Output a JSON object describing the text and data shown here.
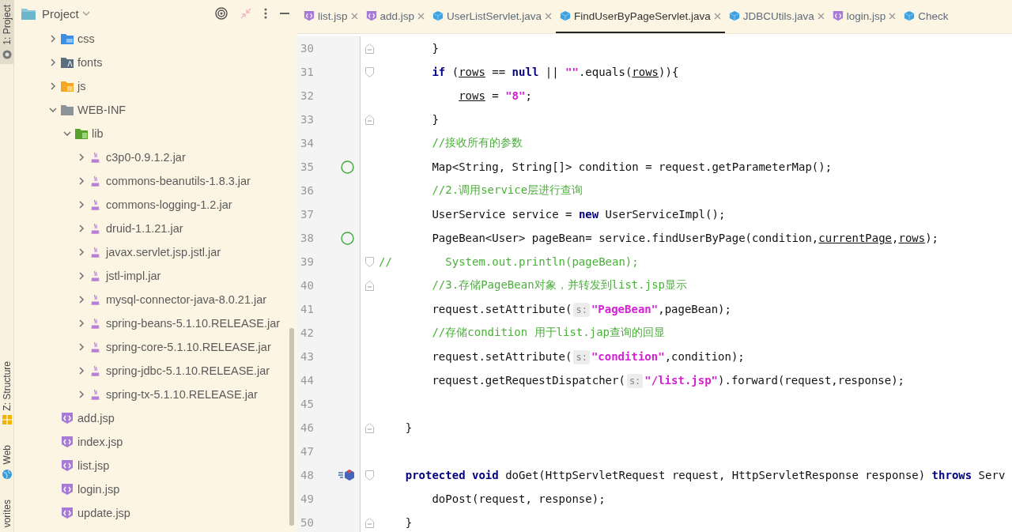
{
  "tool_stripe": [
    {
      "label": "1: Project",
      "kind": "project",
      "selected": true
    },
    {
      "label": "Z: Structure",
      "kind": "structure",
      "selected": false
    },
    {
      "label": "Web",
      "kind": "web",
      "selected": false
    },
    {
      "label": "vorites",
      "kind": "favorites",
      "selected": false
    }
  ],
  "project_panel": {
    "title": "Project",
    "tree": [
      {
        "label": "css",
        "kind": "css-folder",
        "expanded": false
      },
      {
        "label": "fonts",
        "kind": "fonts-folder",
        "expanded": false
      },
      {
        "label": "js",
        "kind": "js-folder",
        "expanded": false
      },
      {
        "label": "WEB-INF",
        "kind": "folder",
        "expanded": true,
        "children": [
          {
            "label": "lib",
            "kind": "lib-folder",
            "expanded": true,
            "children": [
              {
                "label": "c3p0-0.9.1.2.jar",
                "kind": "jar",
                "expanded": false
              },
              {
                "label": "commons-beanutils-1.8.3.jar",
                "kind": "jar",
                "expanded": false
              },
              {
                "label": "commons-logging-1.2.jar",
                "kind": "jar",
                "expanded": false
              },
              {
                "label": "druid-1.1.21.jar",
                "kind": "jar",
                "expanded": false
              },
              {
                "label": "javax.servlet.jsp.jstl.jar",
                "kind": "jar",
                "expanded": false
              },
              {
                "label": "jstl-impl.jar",
                "kind": "jar",
                "expanded": false
              },
              {
                "label": "mysql-connector-java-8.0.21.jar",
                "kind": "jar",
                "expanded": false
              },
              {
                "label": "spring-beans-5.1.10.RELEASE.jar",
                "kind": "jar",
                "expanded": false
              },
              {
                "label": "spring-core-5.1.10.RELEASE.jar",
                "kind": "jar",
                "expanded": false
              },
              {
                "label": "spring-jdbc-5.1.10.RELEASE.jar",
                "kind": "jar",
                "expanded": false
              },
              {
                "label": "spring-tx-5.1.10.RELEASE.jar",
                "kind": "jar",
                "expanded": false
              }
            ]
          }
        ]
      },
      {
        "label": "add.jsp",
        "kind": "jsp"
      },
      {
        "label": "index.jsp",
        "kind": "jsp"
      },
      {
        "label": "list.jsp",
        "kind": "jsp"
      },
      {
        "label": "login.jsp",
        "kind": "jsp"
      },
      {
        "label": "update.jsp",
        "kind": "jsp"
      }
    ]
  },
  "editor_tabs": [
    {
      "label": "list.jsp",
      "kind": "jsp",
      "selected": false,
      "closable": true
    },
    {
      "label": "add.jsp",
      "kind": "jsp",
      "selected": false,
      "closable": true
    },
    {
      "label": "UserListServlet.java",
      "kind": "java",
      "selected": false,
      "closable": true
    },
    {
      "label": "FindUserByPageServlet.java",
      "kind": "java",
      "selected": true,
      "closable": true
    },
    {
      "label": "JDBCUtils.java",
      "kind": "java",
      "selected": false,
      "closable": true
    },
    {
      "label": "login.jsp",
      "kind": "jsp",
      "selected": false,
      "closable": true
    },
    {
      "label": "Check",
      "kind": "java",
      "selected": false,
      "closable": false
    }
  ],
  "code_lines": [
    {
      "number": "30",
      "markers": [
        {
          "kind": "fold-end"
        }
      ],
      "tokens": [
        {
          "kind": "indent"
        },
        {
          "kind": "indent"
        },
        {
          "kind": "plain",
          "text": "}"
        }
      ]
    },
    {
      "number": "31",
      "markers": [
        {
          "kind": "fold-start"
        }
      ],
      "tokens": [
        {
          "kind": "indent"
        },
        {
          "kind": "indent"
        },
        {
          "kind": "keyword",
          "text": "if"
        },
        {
          "kind": "plain",
          "text": " ("
        },
        {
          "kind": "variable",
          "text": "rows"
        },
        {
          "kind": "plain",
          "text": " == "
        },
        {
          "kind": "keyword",
          "text": "null"
        },
        {
          "kind": "plain",
          "text": " || "
        },
        {
          "kind": "string",
          "text": "\"\""
        },
        {
          "kind": "plain",
          "text": ".equals("
        },
        {
          "kind": "variable",
          "text": "rows"
        },
        {
          "kind": "plain",
          "text": ")){"
        }
      ]
    },
    {
      "number": "32",
      "tokens": [
        {
          "kind": "indent"
        },
        {
          "kind": "indent"
        },
        {
          "kind": "indent"
        },
        {
          "kind": "variable",
          "text": "rows"
        },
        {
          "kind": "plain",
          "text": " = "
        },
        {
          "kind": "string",
          "text": "\"8\""
        },
        {
          "kind": "plain",
          "text": ";"
        }
      ]
    },
    {
      "number": "33",
      "markers": [
        {
          "kind": "fold-end"
        }
      ],
      "tokens": [
        {
          "kind": "indent"
        },
        {
          "kind": "indent"
        },
        {
          "kind": "plain",
          "text": "}"
        }
      ]
    },
    {
      "number": "34",
      "tokens": [
        {
          "kind": "indent"
        },
        {
          "kind": "indent"
        },
        {
          "kind": "comment",
          "text": "//接收所有的参数"
        }
      ]
    },
    {
      "number": "35",
      "markers": [
        {
          "kind": "implements"
        }
      ],
      "tokens": [
        {
          "kind": "indent"
        },
        {
          "kind": "indent"
        },
        {
          "kind": "plain",
          "text": "Map<String, String[]> condition = request.getParameterMap();"
        }
      ]
    },
    {
      "number": "36",
      "tokens": [
        {
          "kind": "indent"
        },
        {
          "kind": "indent"
        },
        {
          "kind": "comment",
          "text": "//2.调用service层进行查询"
        }
      ]
    },
    {
      "number": "37",
      "tokens": [
        {
          "kind": "indent"
        },
        {
          "kind": "indent"
        },
        {
          "kind": "plain",
          "text": "UserService service = "
        },
        {
          "kind": "keyword",
          "text": "new"
        },
        {
          "kind": "plain",
          "text": " UserServiceImpl();"
        }
      ]
    },
    {
      "number": "38",
      "markers": [
        {
          "kind": "implements"
        }
      ],
      "tokens": [
        {
          "kind": "indent"
        },
        {
          "kind": "indent"
        },
        {
          "kind": "plain",
          "text": "PageBean<User> pageBean= service.findUserByPage(condition,"
        },
        {
          "kind": "variable",
          "text": "currentPage"
        },
        {
          "kind": "plain",
          "text": ","
        },
        {
          "kind": "variable",
          "text": "rows"
        },
        {
          "kind": "plain",
          "text": ");"
        }
      ]
    },
    {
      "number": "39",
      "markers": [
        {
          "kind": "fold-start"
        }
      ],
      "tokens": [
        {
          "kind": "comment",
          "text": "//        System.out.println(pageBean);"
        }
      ]
    },
    {
      "number": "40",
      "markers": [
        {
          "kind": "fold-end"
        }
      ],
      "tokens": [
        {
          "kind": "indent"
        },
        {
          "kind": "indent"
        },
        {
          "kind": "comment",
          "text": "//3.存储PageBean对象，并转发到list.jsp显示"
        }
      ]
    },
    {
      "number": "41",
      "tokens": [
        {
          "kind": "indent"
        },
        {
          "kind": "indent"
        },
        {
          "kind": "plain",
          "text": "request.setAttribute("
        },
        {
          "kind": "hint",
          "text": "s:"
        },
        {
          "kind": "string",
          "text": "\"PageBean\""
        },
        {
          "kind": "plain",
          "text": ",pageBean);"
        }
      ]
    },
    {
      "number": "42",
      "tokens": [
        {
          "kind": "indent"
        },
        {
          "kind": "indent"
        },
        {
          "kind": "comment",
          "text": "//存储condition 用于list.jap查询的回显"
        }
      ]
    },
    {
      "number": "43",
      "tokens": [
        {
          "kind": "indent"
        },
        {
          "kind": "indent"
        },
        {
          "kind": "plain",
          "text": "request.setAttribute("
        },
        {
          "kind": "hint",
          "text": "s:"
        },
        {
          "kind": "string",
          "text": "\"condition\""
        },
        {
          "kind": "plain",
          "text": ",condition);"
        }
      ]
    },
    {
      "number": "44",
      "tokens": [
        {
          "kind": "indent"
        },
        {
          "kind": "indent"
        },
        {
          "kind": "plain",
          "text": "request.getRequestDispatcher("
        },
        {
          "kind": "hint",
          "text": "s:"
        },
        {
          "kind": "string",
          "text": "\"/list.jsp\""
        },
        {
          "kind": "plain",
          "text": ").forward(request,response);"
        }
      ]
    },
    {
      "number": "45"
    },
    {
      "number": "46",
      "markers": [
        {
          "kind": "fold-end"
        }
      ],
      "tokens": [
        {
          "kind": "indent"
        },
        {
          "kind": "plain",
          "text": "}"
        }
      ]
    },
    {
      "number": "47"
    },
    {
      "number": "48",
      "markers": [
        {
          "kind": "override"
        },
        {
          "kind": "fold-start"
        }
      ],
      "tokens": [
        {
          "kind": "indent"
        },
        {
          "kind": "keyword",
          "text": "protected"
        },
        {
          "kind": "space"
        },
        {
          "kind": "keyword",
          "text": "void"
        },
        {
          "kind": "plain",
          "text": " doGet(HttpServletRequest request, HttpServletResponse response) "
        },
        {
          "kind": "keyword",
          "text": "throws"
        },
        {
          "kind": "plain",
          "text": " Serv"
        }
      ]
    },
    {
      "number": "49",
      "tokens": [
        {
          "kind": "indent"
        },
        {
          "kind": "indent"
        },
        {
          "kind": "plain",
          "text": "doPost(request, response);"
        }
      ]
    },
    {
      "number": "50",
      "markers": [
        {
          "kind": "fold-end"
        }
      ],
      "tokens": [
        {
          "kind": "indent"
        },
        {
          "kind": "plain",
          "text": "}"
        }
      ]
    }
  ]
}
